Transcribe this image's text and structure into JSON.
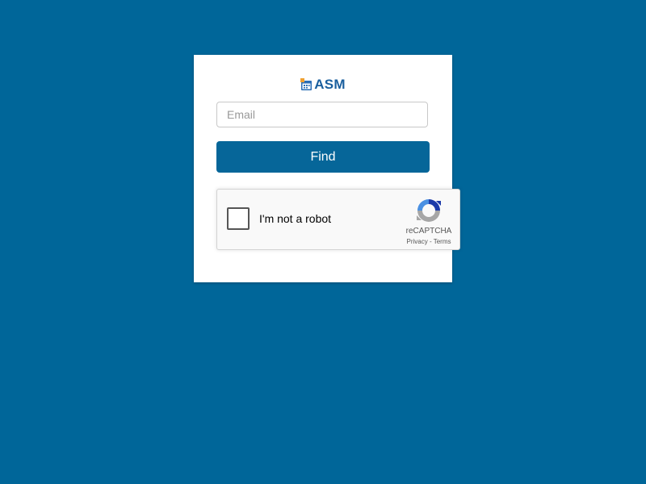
{
  "brand": {
    "name": "ASM",
    "icon": "calendar-logo-icon",
    "color": "#1a5f9e"
  },
  "form": {
    "email_placeholder": "Email",
    "email_value": "",
    "submit_label": "Find"
  },
  "captcha": {
    "label": "I'm not a robot",
    "brand": "reCAPTCHA",
    "privacy_link": "Privacy",
    "separator": "-",
    "terms_link": "Terms",
    "checked": false
  },
  "colors": {
    "background": "#006699",
    "button": "#066699",
    "card": "#ffffff"
  }
}
